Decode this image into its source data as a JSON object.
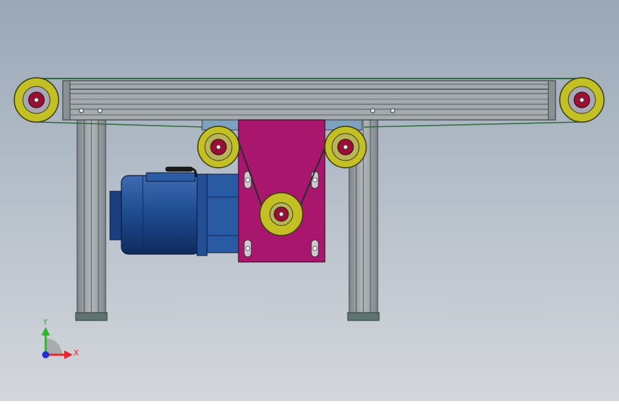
{
  "triad": {
    "x_label": "X",
    "y_label": "Y",
    "x_color": "#e8242c",
    "y_color": "#2fb52f",
    "z_color": "#2030d0"
  },
  "colors": {
    "background_top": "#9aa8b8",
    "background_bottom": "#d2d6dc",
    "frame": "#9aa0a3",
    "pulley_outer": "#c2c025",
    "pulley_hub": "#9a0f34",
    "motor": "#1f4d92",
    "bracket": "#a8166e",
    "belt": "#3a3a3a"
  }
}
